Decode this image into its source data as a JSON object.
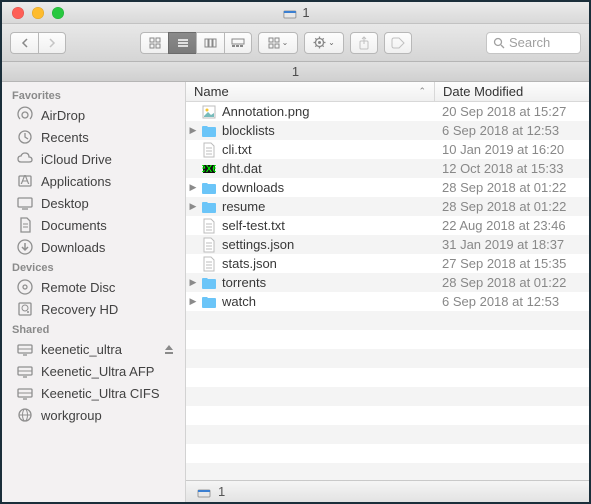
{
  "window": {
    "title": "1"
  },
  "traffic": {
    "close": "#fe5f57",
    "min": "#febc2e",
    "max": "#28c840"
  },
  "toolbar": {
    "search_placeholder": "Search"
  },
  "pathbar": {
    "label": "1"
  },
  "sidebar": {
    "sections": [
      {
        "label": "Favorites",
        "items": [
          {
            "icon": "airdrop",
            "label": "AirDrop"
          },
          {
            "icon": "recents",
            "label": "Recents"
          },
          {
            "icon": "icloud",
            "label": "iCloud Drive"
          },
          {
            "icon": "apps",
            "label": "Applications"
          },
          {
            "icon": "desktop",
            "label": "Desktop"
          },
          {
            "icon": "documents",
            "label": "Documents"
          },
          {
            "icon": "downloads",
            "label": "Downloads"
          }
        ]
      },
      {
        "label": "Devices",
        "items": [
          {
            "icon": "disc",
            "label": "Remote Disc"
          },
          {
            "icon": "hdd",
            "label": "Recovery HD"
          }
        ]
      },
      {
        "label": "Shared",
        "items": [
          {
            "icon": "server",
            "label": "keenetic_ultra",
            "eject": true
          },
          {
            "icon": "server",
            "label": "Keenetic_Ultra AFP"
          },
          {
            "icon": "server",
            "label": "Keenetic_Ultra CIFS"
          },
          {
            "icon": "globe",
            "label": "workgroup"
          }
        ]
      }
    ]
  },
  "columns": {
    "name": "Name",
    "date": "Date Modified"
  },
  "files": [
    {
      "type": "image",
      "name": "Annotation.png",
      "date": "20 Sep 2018 at 15:27",
      "expand": false
    },
    {
      "type": "folder",
      "name": "blocklists",
      "date": "6 Sep 2018 at 12:53",
      "expand": true
    },
    {
      "type": "txt",
      "name": "cli.txt",
      "date": "10 Jan 2019 at 16:20",
      "expand": false
    },
    {
      "type": "dat",
      "name": "dht.dat",
      "date": "12 Oct 2018 at 15:33",
      "expand": false
    },
    {
      "type": "folder",
      "name": "downloads",
      "date": "28 Sep 2018 at 01:22",
      "expand": true
    },
    {
      "type": "folder",
      "name": "resume",
      "date": "28 Sep 2018 at 01:22",
      "expand": true
    },
    {
      "type": "txt",
      "name": "self-test.txt",
      "date": "22 Aug 2018 at 23:46",
      "expand": false
    },
    {
      "type": "txt",
      "name": "settings.json",
      "date": "31 Jan 2019 at 18:37",
      "expand": false
    },
    {
      "type": "txt",
      "name": "stats.json",
      "date": "27 Sep 2018 at 15:35",
      "expand": false
    },
    {
      "type": "folder",
      "name": "torrents",
      "date": "28 Sep 2018 at 01:22",
      "expand": true
    },
    {
      "type": "folder",
      "name": "watch",
      "date": "6 Sep 2018 at 12:53",
      "expand": true
    }
  ],
  "statusbar": {
    "label": "1"
  }
}
